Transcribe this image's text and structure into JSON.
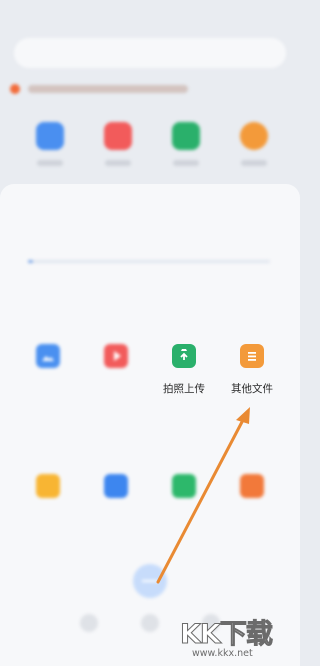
{
  "background_app": {
    "icons": [
      "image-icon",
      "video-icon",
      "doc-icon",
      "music-icon"
    ]
  },
  "sheet": {
    "title": "",
    "subtitle": "",
    "storage_progress": 0.02,
    "upload_section": {
      "heading": "",
      "items": [
        {
          "label": "",
          "icon": "image-icon",
          "color": "#4a90f0"
        },
        {
          "label": "",
          "icon": "video-icon",
          "color": "#f25b5b"
        },
        {
          "label": "拍照上传",
          "icon": "camera-upload-icon",
          "color": "#2ab06b"
        },
        {
          "label": "其他文件",
          "icon": "file-icon",
          "color": "#f39a3a"
        }
      ]
    },
    "new_section": {
      "heading": "",
      "items": [
        {
          "label": "",
          "icon": "folder-icon",
          "color": "#f8b533"
        },
        {
          "label": "",
          "icon": "note-icon",
          "color": "#3d86ef"
        },
        {
          "label": "",
          "icon": "table-icon",
          "color": "#2db86b"
        },
        {
          "label": "",
          "icon": "slides-icon",
          "color": "#f2793a"
        }
      ]
    }
  },
  "watermark": {
    "title": "KK下载",
    "url": "www.kkx.net"
  }
}
